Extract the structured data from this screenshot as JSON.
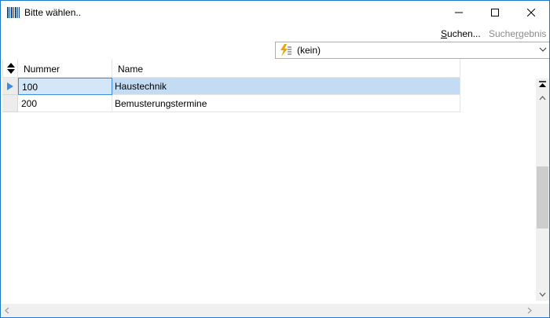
{
  "window": {
    "title": "Bitte wählen..",
    "icon": "barcode-icon",
    "controls": [
      "minimize-icon",
      "maximize-icon",
      "close-icon"
    ]
  },
  "toolbar": {
    "search_label": "Suchen...",
    "result_label": "Suchergebnis"
  },
  "filter": {
    "icon": "filter-lightning-icon",
    "value": "(kein)"
  },
  "grid": {
    "columns": [
      "Nummer",
      "Name"
    ],
    "rows": [
      {
        "nummer": "100",
        "name": "Haustechnik",
        "selected": true
      },
      {
        "nummer": "200",
        "name": "Bemusterungstermine",
        "selected": false
      }
    ]
  },
  "colors": {
    "accent": "#3a8fdc",
    "selection": "#c4dcf3",
    "window_border": "#1979ca"
  }
}
